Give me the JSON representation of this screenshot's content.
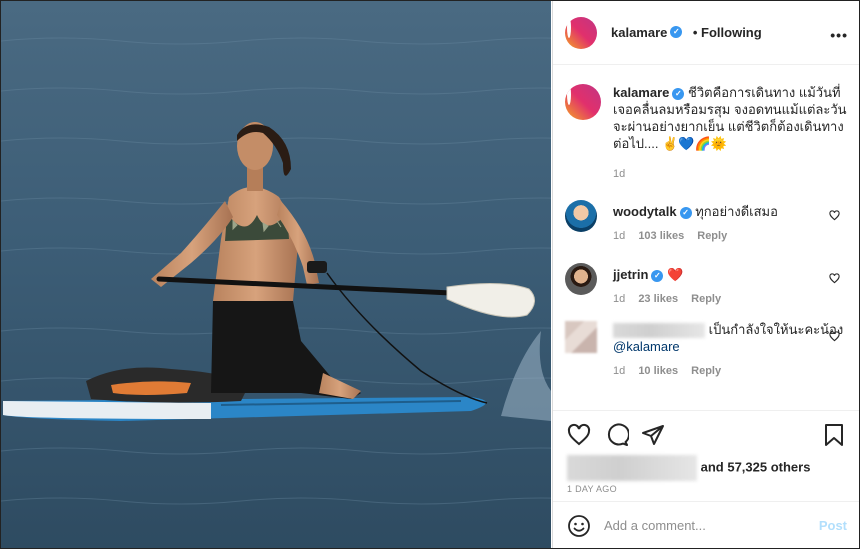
{
  "post": {
    "image_alt": "woman kneeling on paddle board at sea",
    "author": "kalamare",
    "dot": "•",
    "follow_status": "Following",
    "more_icon": "more-options-icon",
    "caption": "ชีวิตคือการเดินทาง แม้วันที่เจอคลื่นลมหรือมรสุม จงอดทนแม้แต่ละวันจะผ่านอย่างยากเย็น แต่ชีวิตก็ต้องเดินทางต่อไป.... ✌💙🌈🌞",
    "caption_time": "1d"
  },
  "comments": [
    {
      "user": "woodytalk",
      "text": "ทุกอย่างดีเสมอ",
      "time": "1d",
      "likes": "103 likes",
      "reply": "Reply"
    },
    {
      "user": "jjetrin",
      "text": "❤️",
      "time": "1d",
      "likes": "23 likes",
      "reply": "Reply"
    },
    {
      "user": "",
      "text": "เป็นกำลังใจให้นะคะน้อง",
      "mention": "@kalamare",
      "time": "1d",
      "likes": "10 likes",
      "reply": "Reply"
    }
  ],
  "actions": {
    "likes_suffix": "and 57,325 others",
    "date": "1 DAY AGO"
  },
  "add_comment": {
    "placeholder": "Add a comment...",
    "post_label": "Post"
  },
  "colors": {
    "verified": "#3897f0",
    "link": "#00376b",
    "post_button": "#b2dffc"
  }
}
